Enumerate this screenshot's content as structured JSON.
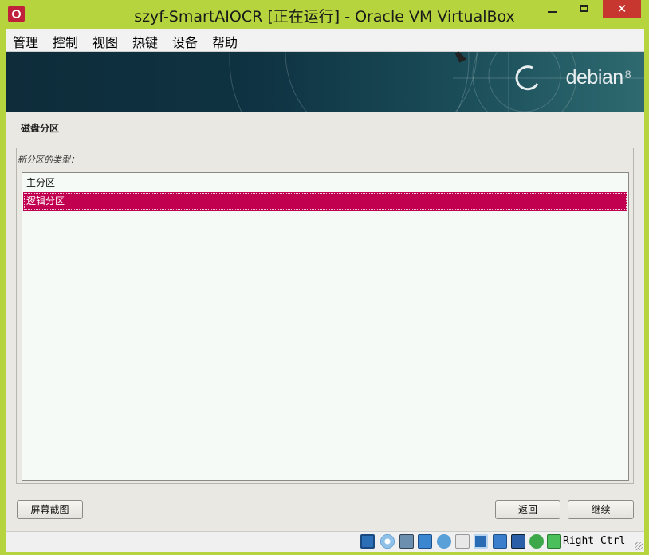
{
  "window": {
    "title": "szyf-SmartAIOCR [正在运行] - Oracle VM VirtualBox",
    "close_glyph": "✕"
  },
  "menu": {
    "items": [
      "管理",
      "控制",
      "视图",
      "热键",
      "设备",
      "帮助"
    ]
  },
  "banner": {
    "logo_text": "debian",
    "logo_version": "8"
  },
  "installer": {
    "section_title": "磁盘分区",
    "question": "新分区的类型：",
    "options": [
      {
        "label": "主分区",
        "selected": false
      },
      {
        "label": "逻辑分区",
        "selected": true
      }
    ],
    "buttons": {
      "screenshot": "屏幕截图",
      "back": "返回",
      "continue": "继续"
    }
  },
  "statusbar": {
    "host_key": "Right Ctrl",
    "icons": [
      "hard-disk-icon",
      "optical-drive-icon",
      "audio-icon",
      "network-icon",
      "usb-icon",
      "shared-folders-icon",
      "display-icon",
      "video-capture-icon",
      "virtualization-icon",
      "mouse-integration-icon",
      "download-icon"
    ],
    "colors": {
      "selection": "#c20050",
      "accent_blue": "#1e78c8"
    }
  }
}
